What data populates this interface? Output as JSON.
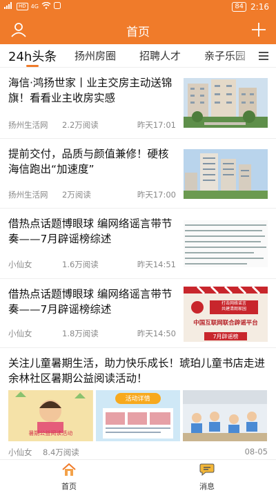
{
  "status_bar": {
    "sim1": "HD",
    "sim2": "HD",
    "network": "4G",
    "battery": "84",
    "time": "2:16"
  },
  "header": {
    "title": "首页"
  },
  "tabs": [
    {
      "label": "24h头条",
      "active": true
    },
    {
      "label": "扬州房圈",
      "active": false
    },
    {
      "label": "招聘人才",
      "active": false
    },
    {
      "label": "亲子乐园",
      "active": false
    }
  ],
  "articles": [
    {
      "title": "海信·鸿扬世家丨业主交房主动送锦旗！看看业主收房实感",
      "source": "扬州生活网",
      "views": "2.2万阅读",
      "time": "昨天17:01"
    },
    {
      "title": "提前交付，品质与颜值兼修！硬核海信跑出“加速度”",
      "source": "扬州生活网",
      "views": "2万阅读",
      "time": "昨天17:00"
    },
    {
      "title": "借热点话题博眼球 编网络谣言带节奏——7月辟谣榜综述",
      "source": "小仙女",
      "views": "1.6万阅读",
      "time": "昨天14:51"
    },
    {
      "title": "借热点话题博眼球 编网络谣言带节奏——7月辟谣榜综述",
      "source": "小仙女",
      "views": "1.8万阅读",
      "time": "昨天14:50",
      "thumb_text": {
        "line1": "打击网络谣言",
        "line2": "共建清朗家园",
        "line3": "中国互联网联合辟谣平台",
        "line4": "7月辟谣榜"
      }
    },
    {
      "title": "关注儿童暑期生活，助力快乐成长！琥珀儿童书店走进余林社区暑期公益阅读活动！",
      "source": "小仙女",
      "views": "8.4万阅读",
      "time": "08-05",
      "thumb_labels": [
        "暑期公益阅读活动",
        "活动详情"
      ]
    }
  ],
  "bottom_nav": [
    {
      "label": "首页",
      "active": true
    },
    {
      "label": "消息",
      "active": false
    }
  ],
  "colors": {
    "accent": "#f07b2a"
  }
}
